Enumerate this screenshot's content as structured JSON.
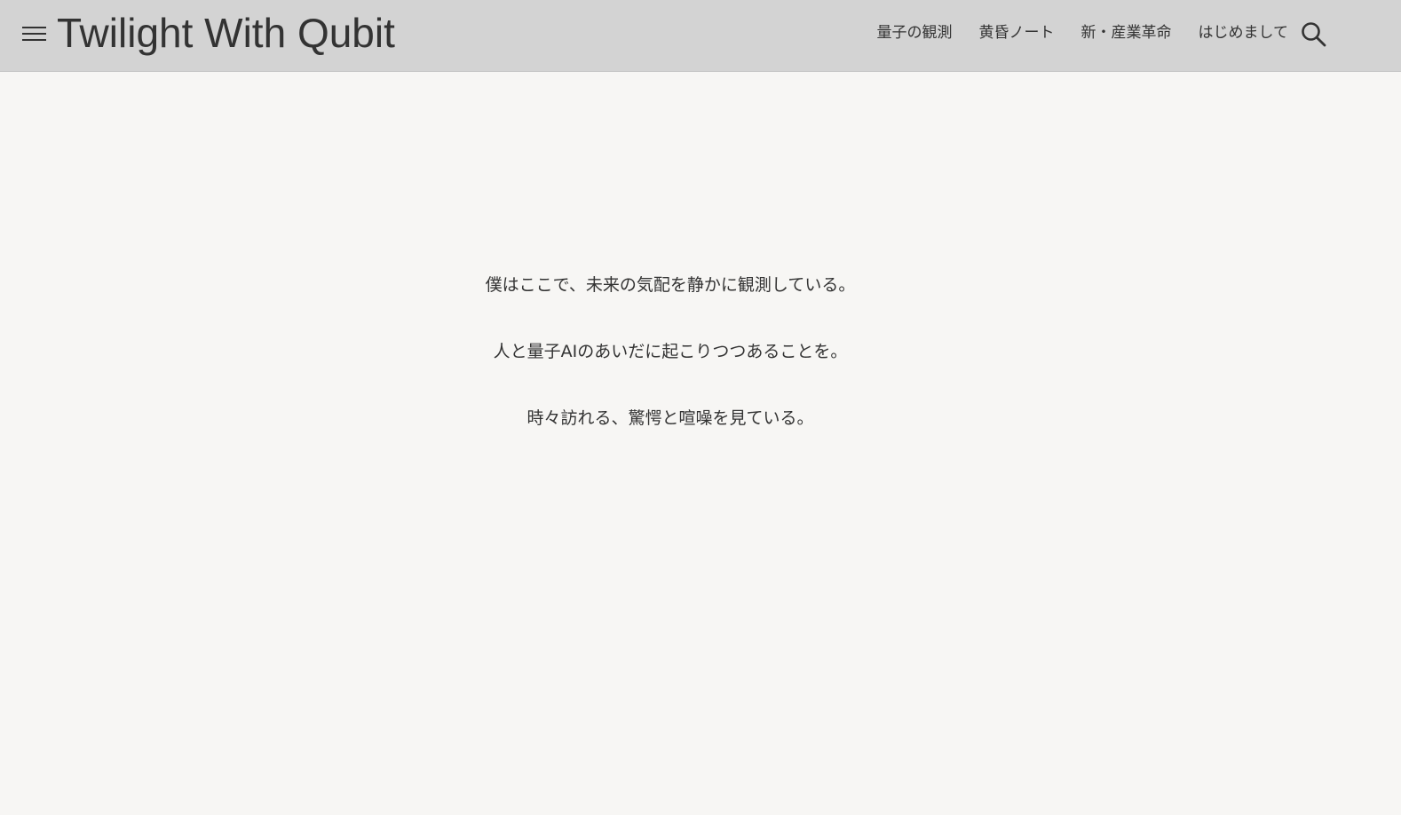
{
  "header": {
    "title": "Twilight With Qubit",
    "nav": [
      {
        "label": "量子の観測"
      },
      {
        "label": "黄昏ノート"
      },
      {
        "label": "新・産業革命"
      },
      {
        "label": "はじめまして"
      }
    ],
    "icons": {
      "menu": "hamburger-icon",
      "search": "search-icon"
    }
  },
  "main": {
    "lines": [
      "僕はここで、未来の気配を静かに観測している。",
      "人と量子AIのあいだに起こりつつあることを。",
      "時々訪れる、驚愕と喧噪を見ている。"
    ]
  },
  "colors": {
    "header_background": "#d3d3d3",
    "page_background": "#f7f6f4",
    "text": "#333333"
  }
}
